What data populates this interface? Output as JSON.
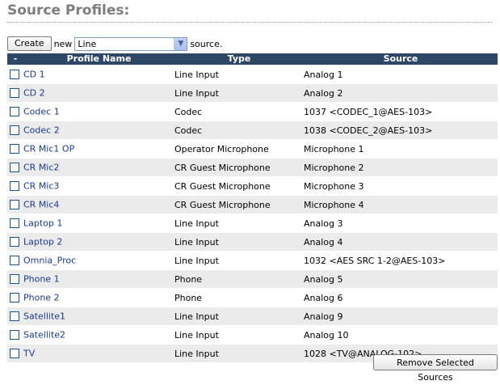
{
  "page": {
    "title": "Source Profiles:"
  },
  "create": {
    "button_label": "Create",
    "prefix": "new",
    "selected_type": "Line",
    "suffix": "source."
  },
  "table": {
    "headers": {
      "select": "-",
      "name": "Profile Name",
      "type": "Type",
      "source": "Source"
    },
    "rows": [
      {
        "name": "CD 1",
        "type": "Line Input",
        "source": "Analog 1"
      },
      {
        "name": "CD 2",
        "type": "Line Input",
        "source": "Analog 2"
      },
      {
        "name": "Codec 1",
        "type": "Codec",
        "source": "1037 <CODEC_1@AES-103>"
      },
      {
        "name": "Codec 2",
        "type": "Codec",
        "source": "1038 <CODEC_2@AES-103>"
      },
      {
        "name": "CR Mic1 OP",
        "type": "Operator Microphone",
        "source": "Microphone 1"
      },
      {
        "name": "CR Mic2",
        "type": "CR Guest Microphone",
        "source": "Microphone 2"
      },
      {
        "name": "CR Mic3",
        "type": "CR Guest Microphone",
        "source": "Microphone 3"
      },
      {
        "name": "CR Mic4",
        "type": "CR Guest Microphone",
        "source": "Microphone 4"
      },
      {
        "name": "Laptop 1",
        "type": "Line Input",
        "source": "Analog 3"
      },
      {
        "name": "Laptop 2",
        "type": "Line Input",
        "source": "Analog 4"
      },
      {
        "name": "Omnia_Proc",
        "type": "Line Input",
        "source": "1032 <AES SRC 1-2@AES-103>"
      },
      {
        "name": "Phone 1",
        "type": "Phone",
        "source": "Analog 5"
      },
      {
        "name": "Phone 2",
        "type": "Phone",
        "source": "Analog 6"
      },
      {
        "name": "Satellite1",
        "type": "Line Input",
        "source": "Analog 9"
      },
      {
        "name": "Satellite2",
        "type": "Line Input",
        "source": "Analog 10"
      },
      {
        "name": "TV",
        "type": "Line Input",
        "source": "1028 <TV@ANALOG-102>"
      }
    ]
  },
  "footer": {
    "remove_label": "Remove Selected Sources"
  },
  "colors": {
    "header_bg": "#2f4766",
    "row_even": "#ffffff",
    "row_odd": "#ebebeb",
    "link": "#1a3a8c",
    "title": "#7d7d7d"
  }
}
